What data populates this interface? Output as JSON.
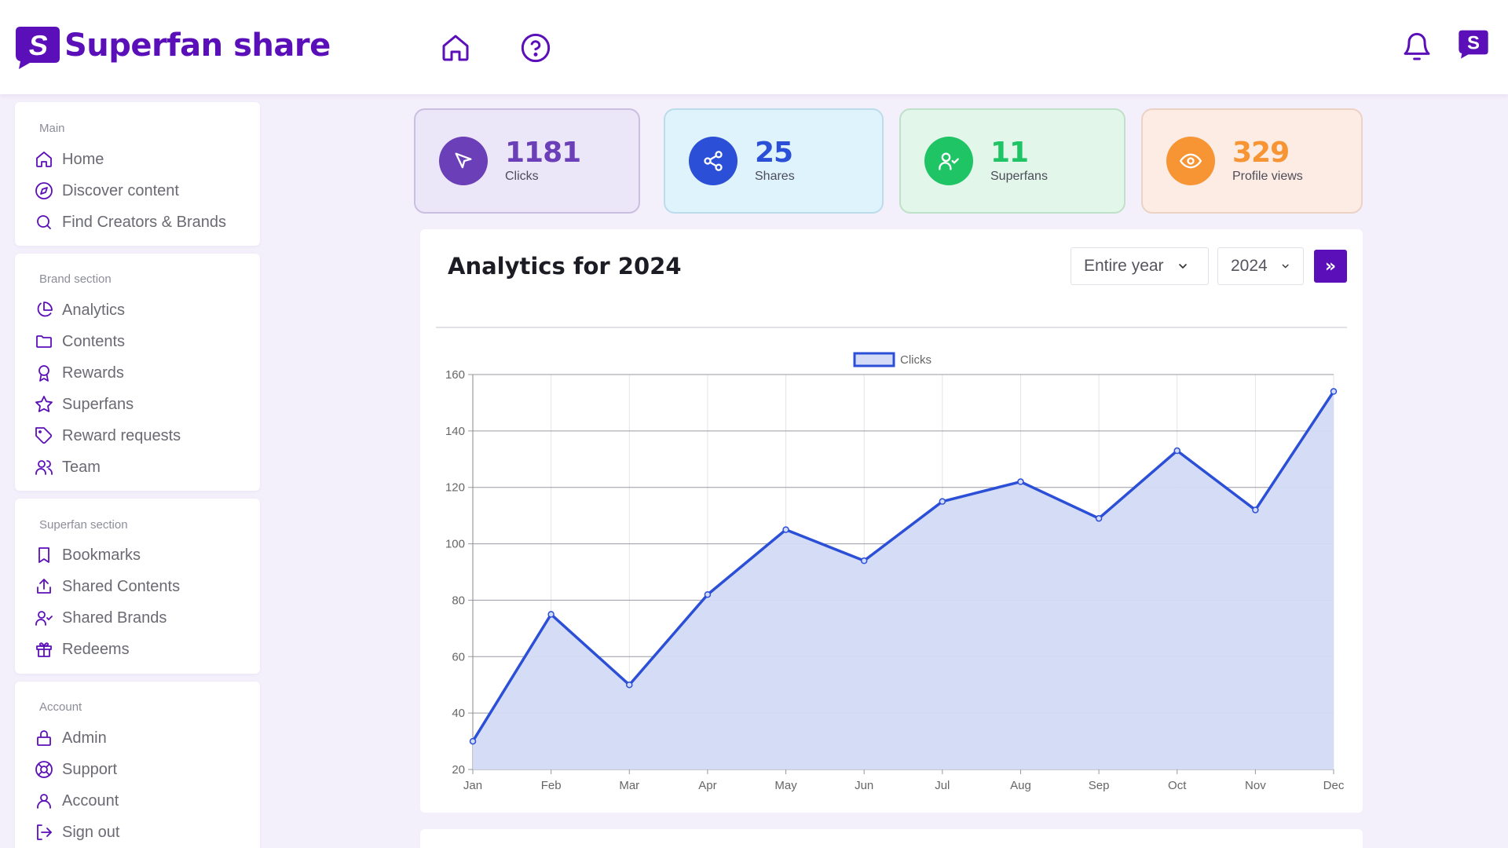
{
  "app": {
    "name": "Superfan share"
  },
  "sidebar": {
    "sections": [
      {
        "title": "Main",
        "items": [
          {
            "label": "Home",
            "icon": "home-icon"
          },
          {
            "label": "Discover content",
            "icon": "compass-icon"
          },
          {
            "label": "Find Creators & Brands",
            "icon": "search-icon"
          }
        ]
      },
      {
        "title": "Brand section",
        "items": [
          {
            "label": "Analytics",
            "icon": "pie-chart-icon"
          },
          {
            "label": "Contents",
            "icon": "folder-icon"
          },
          {
            "label": "Rewards",
            "icon": "award-icon"
          },
          {
            "label": "Superfans",
            "icon": "star-icon"
          },
          {
            "label": "Reward requests",
            "icon": "tag-icon"
          },
          {
            "label": "Team",
            "icon": "users-icon"
          }
        ]
      },
      {
        "title": "Superfan section",
        "items": [
          {
            "label": "Bookmarks",
            "icon": "bookmark-icon"
          },
          {
            "label": "Shared Contents",
            "icon": "share-upload-icon"
          },
          {
            "label": "Shared Brands",
            "icon": "user-check-icon"
          },
          {
            "label": "Redeems",
            "icon": "gift-icon"
          }
        ]
      },
      {
        "title": "Account",
        "items": [
          {
            "label": "Admin",
            "icon": "lock-icon"
          },
          {
            "label": "Support",
            "icon": "lifebuoy-icon"
          },
          {
            "label": "Account",
            "icon": "user-icon"
          },
          {
            "label": "Sign out",
            "icon": "sign-out-icon"
          }
        ]
      }
    ]
  },
  "stats": [
    {
      "value": "1181",
      "label": "Clicks",
      "icon": "cursor-icon",
      "color": "#6b3fb8",
      "bg": "#ece6f9",
      "border": "#c9bfe0"
    },
    {
      "value": "25",
      "label": "Shares",
      "icon": "share-icon",
      "color": "#2b4fd6",
      "bg": "#dff3fd",
      "border": "#bcdcec"
    },
    {
      "value": "11",
      "label": "Superfans",
      "icon": "user-check-icon",
      "color": "#1fc465",
      "bg": "#e2f6ea",
      "border": "#bfe0c9"
    },
    {
      "value": "329",
      "label": "Profile views",
      "icon": "eye-icon",
      "color": "#f79434",
      "bg": "#fdece4",
      "border": "#ebd2c5"
    }
  ],
  "analytics": {
    "title": "Analytics for 2024",
    "period_select": "Entire year",
    "year_select": "2024",
    "go_label": "»"
  },
  "colors": {
    "brand": "#5b0fb8",
    "line": "#2b4fd6",
    "fill": "#d3dbf6"
  },
  "chart_data": {
    "type": "area",
    "categories": [
      "Jan",
      "Feb",
      "Mar",
      "Apr",
      "May",
      "Jun",
      "Jul",
      "Aug",
      "Sep",
      "Oct",
      "Nov",
      "Dec"
    ],
    "series": [
      {
        "name": "Clicks",
        "values": [
          30,
          75,
          50,
          82,
          105,
          94,
          115,
          122,
          109,
          133,
          112,
          154
        ]
      }
    ],
    "ylim": [
      20,
      160
    ],
    "yticks": [
      20,
      40,
      60,
      80,
      100,
      120,
      140,
      160
    ],
    "grid": true,
    "legend": "top-center",
    "xlabel": "",
    "ylabel": ""
  }
}
